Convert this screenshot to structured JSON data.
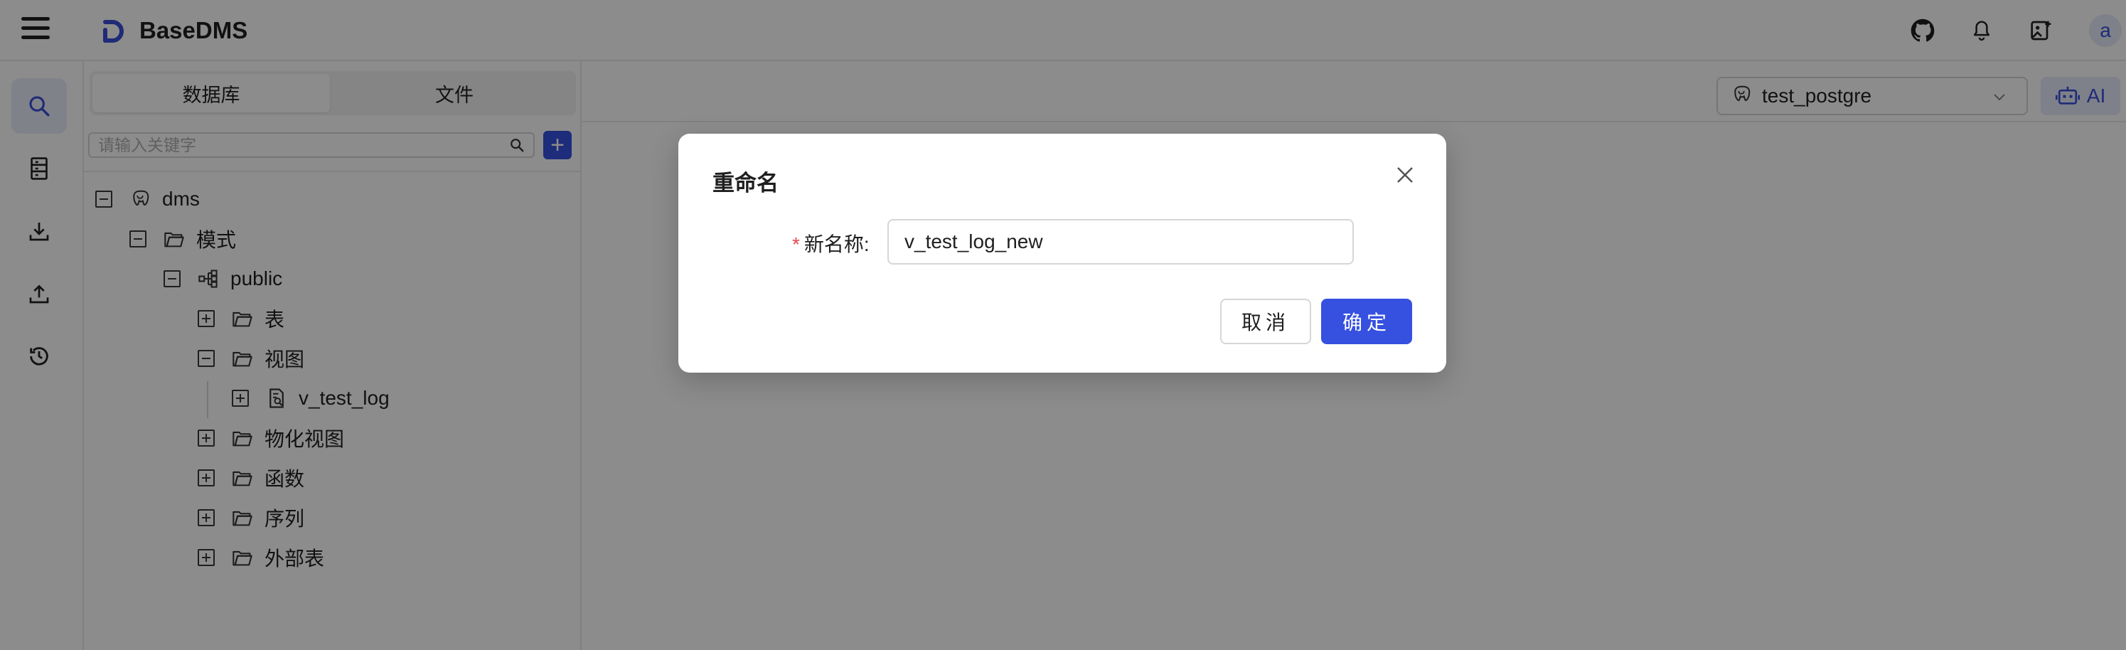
{
  "header": {
    "app_title": "BaseDMS",
    "avatar_letter": "a",
    "icons": [
      "menu-icon",
      "github-icon",
      "bell-icon",
      "image-add-icon"
    ]
  },
  "rail": {
    "items": [
      {
        "icon": "search-icon",
        "active": true
      },
      {
        "icon": "database-icon",
        "active": false
      },
      {
        "icon": "download-icon",
        "active": false
      },
      {
        "icon": "upload-icon",
        "active": false
      },
      {
        "icon": "history-icon",
        "active": false
      }
    ]
  },
  "sidebar": {
    "tabs": [
      {
        "label": "数据库",
        "active": true
      },
      {
        "label": "文件",
        "active": false
      }
    ],
    "search_placeholder": "请输入关键字",
    "add_label": "+",
    "tree": [
      {
        "label": "dms",
        "expanded": true,
        "icon": "postgres-icon"
      },
      {
        "label": "模式",
        "expanded": true,
        "icon": "folder-icon"
      },
      {
        "label": "public",
        "expanded": true,
        "icon": "schema-icon"
      },
      {
        "label": "表",
        "expanded": false,
        "icon": "folder-icon"
      },
      {
        "label": "视图",
        "expanded": true,
        "icon": "folder-icon"
      },
      {
        "label": "v_test_log",
        "expanded": false,
        "icon": "view-icon"
      },
      {
        "label": "物化视图",
        "expanded": false,
        "icon": "folder-icon"
      },
      {
        "label": "函数",
        "expanded": false,
        "icon": "folder-icon"
      },
      {
        "label": "序列",
        "expanded": false,
        "icon": "folder-icon"
      },
      {
        "label": "外部表",
        "expanded": false,
        "icon": "folder-icon"
      }
    ]
  },
  "main": {
    "connection": "test_postgre",
    "ai_label": "AI"
  },
  "modal": {
    "title": "重命名",
    "field_required_mark": "*",
    "field_label": "新名称:",
    "field_value": "v_test_log_new",
    "cancel_label": "取消",
    "ok_label": "确定"
  },
  "colors": {
    "primary": "#3650e0",
    "overlay": "rgba(0,0,0,0.45)",
    "required": "#e5484d"
  }
}
